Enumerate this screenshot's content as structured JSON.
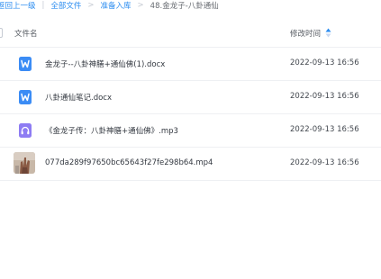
{
  "breadcrumb": {
    "back_label": "返回上一级",
    "items": [
      "全部文件",
      "准备入库"
    ],
    "current": "48.金龙子-八卦通仙"
  },
  "header": {
    "name_label": "文件名",
    "time_label": "修改时间"
  },
  "files": [
    {
      "name": "金龙子--八卦神膳+通仙佛(1).docx",
      "modified": "2022-09-13 16:56",
      "icon": "word-doc-icon"
    },
    {
      "name": "八卦通仙笔记.docx",
      "modified": "2022-09-13 16:56",
      "icon": "word-doc-icon"
    },
    {
      "name": "《金龙子传：八卦神膳+通仙佛》.mp3",
      "modified": "2022-09-13 16:56",
      "icon": "audio-file-icon"
    },
    {
      "name": "077da289f97650bc65643f27fe298b64.mp4",
      "modified": "2022-09-13 16:56",
      "icon": "video-thumbnail"
    }
  ],
  "colors": {
    "link": "#2c8df0",
    "word_icon": "#3b8cf5",
    "audio_icon": "#8e7cf3"
  }
}
